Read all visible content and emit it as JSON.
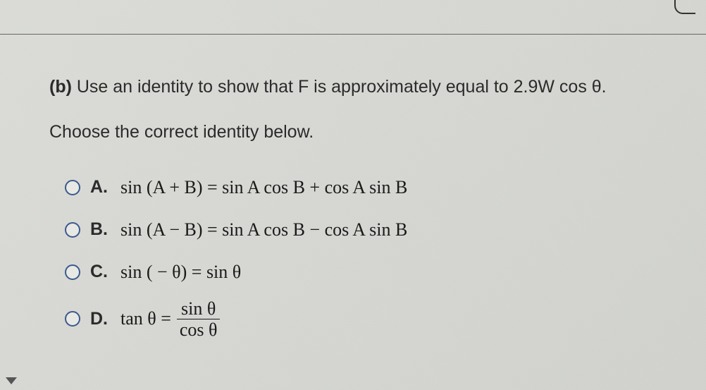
{
  "question": {
    "part_label": "(b)",
    "prompt": "Use an identity to show that F is approximately equal to 2.9W cos θ.",
    "instruction": "Choose the correct identity below."
  },
  "options": [
    {
      "letter": "A.",
      "math": "sin (A + B) = sin A cos B + cos A sin B"
    },
    {
      "letter": "B.",
      "math": "sin (A − B) = sin A cos B − cos A sin B"
    },
    {
      "letter": "C.",
      "math": "sin ( − θ) = sin θ"
    },
    {
      "letter": "D.",
      "math_lhs": "tan θ =",
      "math_num": "sin θ",
      "math_den": "cos θ"
    }
  ]
}
